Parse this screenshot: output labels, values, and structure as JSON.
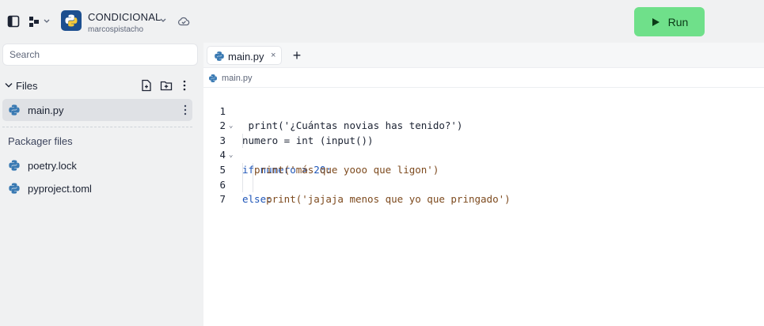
{
  "header": {
    "repl_title": "CONDICIONAL",
    "repl_owner": "marcospistacho",
    "run_label": "Run"
  },
  "sidebar": {
    "search_placeholder": "Search",
    "files_label": "Files",
    "files": [
      {
        "name": "main.py",
        "active": true
      }
    ],
    "packager_label": "Packager files",
    "packager_files": [
      {
        "name": "poetry.lock"
      },
      {
        "name": "pyproject.toml"
      }
    ]
  },
  "editor": {
    "tab_label": "main.py",
    "tab_close": "×",
    "add_tab": "+",
    "breadcrumb": "main.py",
    "line_numbers": [
      "1",
      "2",
      "3",
      "4",
      "5",
      "6",
      "7"
    ],
    "lines": [
      " print('¿Cuántas novias has tenido?')",
      "numero = int (input())",
      "if numero > 20:",
      "  print('más que yooo que ligon')",
      "else:",
      "    print('jajaja menos que yo que pringado')",
      ""
    ]
  },
  "colors": {
    "run_button": "#6fe08a",
    "keyword": "#1f56b8",
    "string": "#7d4a1e",
    "python_blue": "#3a7ab3",
    "python_yellow": "#f5c93a"
  },
  "icons": {
    "sidebar_toggle": "sidebar-toggle-icon",
    "workspace": "workspace-switch-icon",
    "cloud": "cloud-sync-icon",
    "new_file": "new-file-icon",
    "new_folder": "new-folder-icon",
    "more": "kebab-menu-icon",
    "python": "python-icon",
    "play": "play-icon"
  }
}
